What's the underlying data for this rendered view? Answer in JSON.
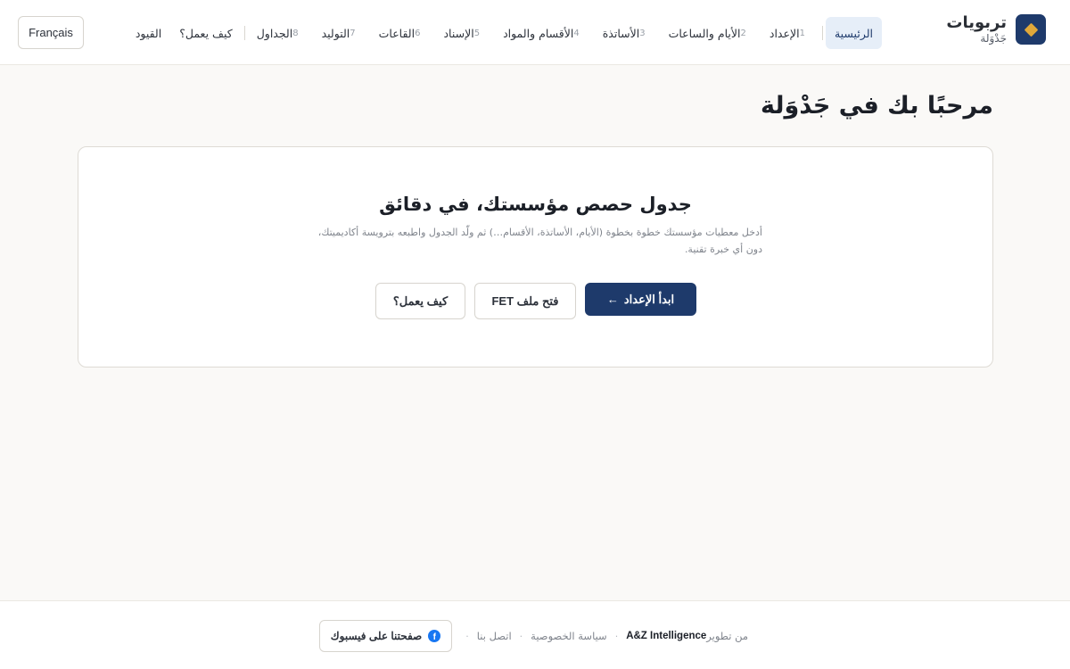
{
  "brand": {
    "name": "تربويات",
    "subtitle": "جَدْوَلة",
    "icon": "diamond-logo-icon",
    "colors": {
      "logo_bg": "#1e3a6b",
      "logo_mark": "#e0a83a"
    }
  },
  "nav": {
    "home": "الرئيسية",
    "steps": [
      {
        "num": "1",
        "label": "الإعداد"
      },
      {
        "num": "2",
        "label": "الأيام والساعات"
      },
      {
        "num": "3",
        "label": "الأساتذة"
      },
      {
        "num": "4",
        "label": "الأقسام والمواد"
      },
      {
        "num": "5",
        "label": "الإسناد"
      },
      {
        "num": "6",
        "label": "القاعات"
      },
      {
        "num": "7",
        "label": "التوليد"
      },
      {
        "num": "8",
        "label": "الجداول"
      }
    ],
    "how_it_works": "كيف يعمل؟",
    "constraints": "القيود",
    "active": "الرئيسية"
  },
  "language_button": "Français",
  "page_title": "مرحبًا بك في جَدْوَلة",
  "hero": {
    "title": "جدول حصص مؤسستك، في دقائق",
    "description": "أدخل معطيات مؤسستك خطوة بخطوة (الأيام، الأساتذة، الأقسام…) ثم ولّد الجدول واطبعه بترويسة أكاديميتك، دون أي خبرة تقنية.",
    "primary_button": "ابدأ الإعداد",
    "primary_icon": "arrow-left-icon",
    "open_fet_button": "فتح ملف FET",
    "how_button": "كيف يعمل؟"
  },
  "footer": {
    "developed_by": "من تطوير",
    "developer": "A&Z Intelligence",
    "privacy": "سياسة الخصوصية",
    "contact": "اتصل بنا",
    "facebook_button": "صفحتنا على فيسبوك",
    "facebook_icon": "facebook-icon",
    "separator": "·"
  },
  "colors": {
    "primary": "#1e3a6b",
    "active_nav_bg": "#e6eef8",
    "page_bg": "#faf9f7"
  }
}
